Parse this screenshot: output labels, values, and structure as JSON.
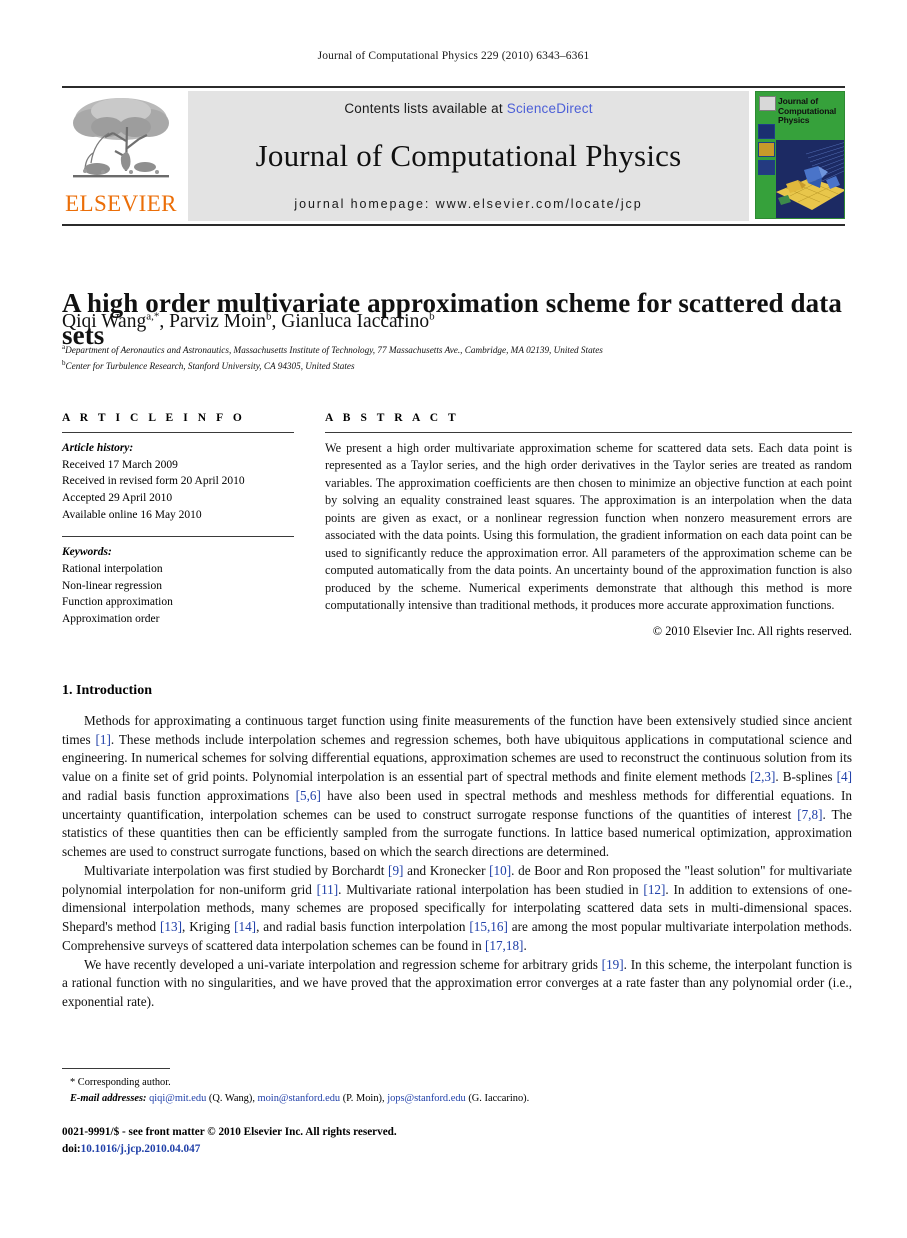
{
  "running_head": "Journal of Computational Physics 229 (2010) 6343–6361",
  "masthead": {
    "contents_prefix": "Contents lists available at ",
    "sciencedirect": "ScienceDirect",
    "journal_title": "Journal of Computational Physics",
    "homepage": "journal homepage: www.elsevier.com/locate/jcp",
    "publisher_wordmark": "ELSEVIER",
    "cover_title": "Journal of Computational Physics",
    "accent_link": "#4c5fd7",
    "accent_publisher": "#eb6e08",
    "cover_green": "#36a13b"
  },
  "article": {
    "title": "A high order multivariate approximation scheme for scattered data sets",
    "authors": "Qiqi Wang a,*, Parviz Moin b, Gianluca Iaccarino b",
    "affiliation_a": "Department of Aeronautics and Astronautics, Massachusetts Institute of Technology, 77 Massachusetts Ave., Cambridge, MA 02139, United States",
    "affiliation_b": "Center for Turbulence Research, Stanford University, CA 94305, United States"
  },
  "info": {
    "heading": "A R T I C L E    I N F O",
    "history_label": "Article history:",
    "history": [
      "Received 17 March 2009",
      "Received in revised form 20 April 2010",
      "Accepted 29 April 2010",
      "Available online 16 May 2010"
    ],
    "keywords_label": "Keywords:",
    "keywords": [
      "Rational interpolation",
      "Non-linear regression",
      "Function approximation",
      "Approximation order"
    ]
  },
  "abstract": {
    "heading": "A B S T R A C T",
    "text": "We present a high order multivariate approximation scheme for scattered data sets. Each data point is represented as a Taylor series, and the high order derivatives in the Taylor series are treated as random variables. The approximation coefficients are then chosen to minimize an objective function at each point by solving an equality constrained least squares. The approximation is an interpolation when the data points are given as exact, or a nonlinear regression function when nonzero measurement errors are associated with the data points. Using this formulation, the gradient information on each data point can be used to significantly reduce the approximation error. All parameters of the approximation scheme can be computed automatically from the data points. An uncertainty bound of the approximation function is also produced by the scheme. Numerical experiments demonstrate that although this method is more computationally intensive than traditional methods, it produces more accurate approximation functions.",
    "copyright": "© 2010 Elsevier Inc. All rights reserved."
  },
  "body": {
    "section_heading": "1. Introduction",
    "paragraphs": [
      "Methods for approximating a continuous target function using finite measurements of the function have been extensively studied since ancient times [1]. These methods include interpolation schemes and regression schemes, both have ubiquitous applications in computational science and engineering. In numerical schemes for solving differential equations, approximation schemes are used to reconstruct the continuous solution from its value on a finite set of grid points. Polynomial interpolation is an essential part of spectral methods and finite element methods [2,3]. B-splines [4] and radial basis function approximations [5,6] have also been used in spectral methods and meshless methods for differential equations. In uncertainty quantification, interpolation schemes can be used to construct surrogate response functions of the quantities of interest [7,8]. The statistics of these quantities then can be efficiently sampled from the surrogate functions. In lattice based numerical optimization, approximation schemes are used to construct surrogate functions, based on which the search directions are determined.",
      "Multivariate interpolation was first studied by Borchardt [9] and Kronecker [10]. de Boor and Ron proposed the \"least solution\" for multivariate polynomial interpolation for non-uniform grid [11]. Multivariate rational interpolation has been studied in [12]. In addition to extensions of one-dimensional interpolation methods, many schemes are proposed specifically for interpolating scattered data sets in multi-dimensional spaces. Shepard's method [13], Kriging [14], and radial basis function interpolation [15,16] are among the most popular multivariate interpolation methods. Comprehensive surveys of scattered data interpolation schemes can be found in [17,18].",
      "We have recently developed a uni-variate interpolation and regression scheme for arbitrary grids [19]. In this scheme, the interpolant function is a rational function with no singularities, and we have proved that the approximation error converges at a rate faster than any polynomial order (i.e., exponential rate)."
    ]
  },
  "footnotes": {
    "corresponding": "* Corresponding author.",
    "email_label": "E-mail addresses:",
    "emails": [
      {
        "address": "qiqi@mit.edu",
        "name": "(Q. Wang)"
      },
      {
        "address": "moin@stanford.edu",
        "name": "(P. Moin)"
      },
      {
        "address": "jops@stanford.edu",
        "name": "(G. Iaccarino)"
      }
    ]
  },
  "colophon": {
    "issn_line": "0021-9991/$ - see front matter © 2010 Elsevier Inc. All rights reserved.",
    "doi_label": "doi:",
    "doi_value": "10.1016/j.jcp.2010.04.047"
  }
}
